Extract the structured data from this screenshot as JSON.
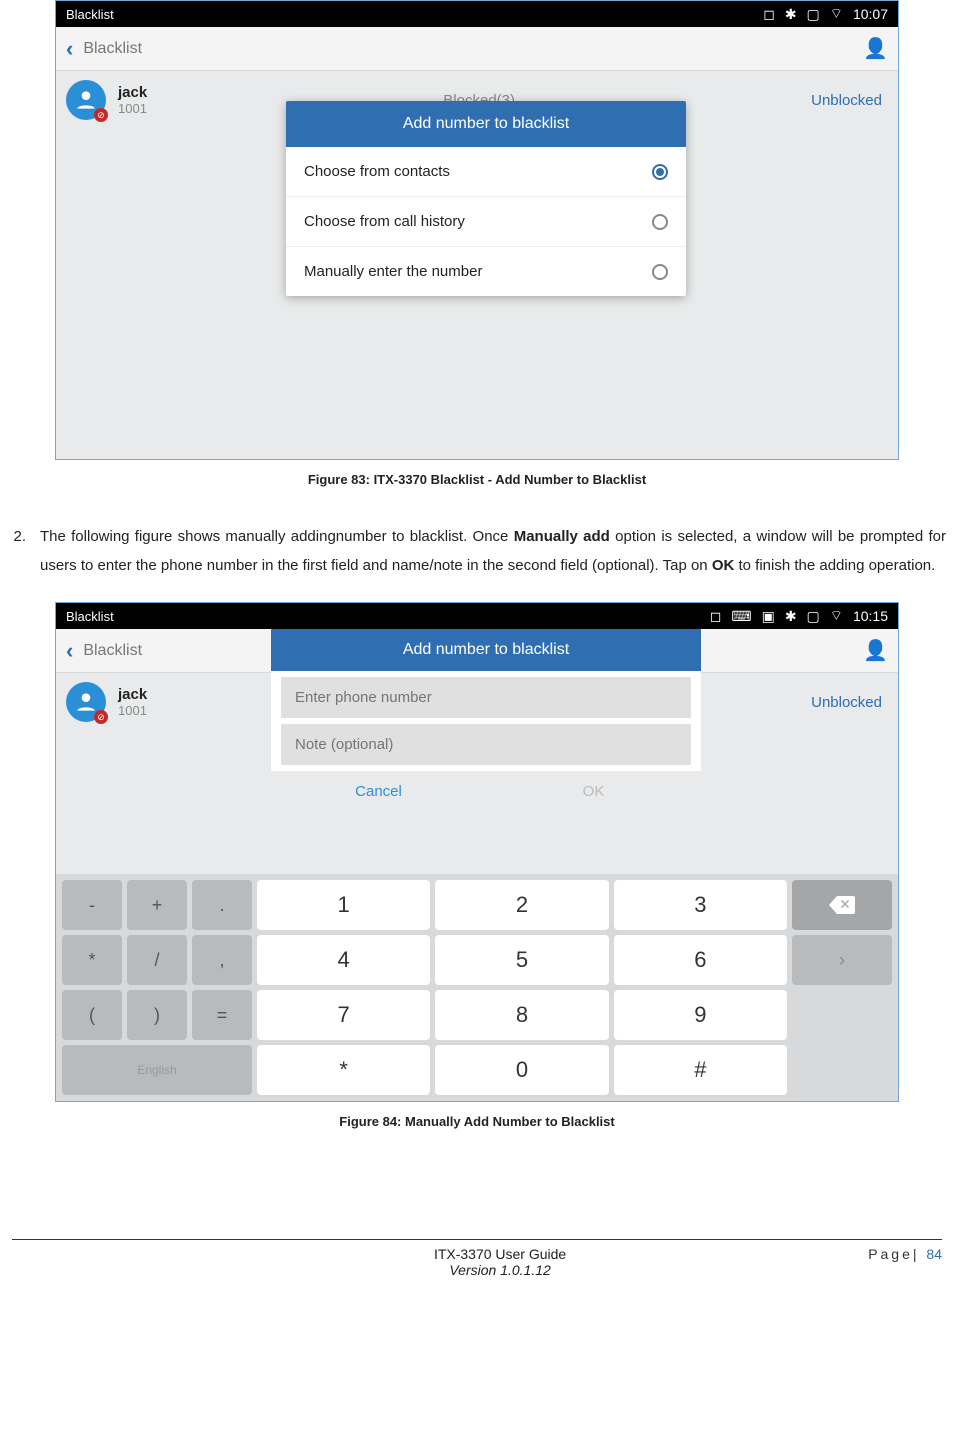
{
  "fig83": {
    "statusbar": {
      "title": "Blacklist",
      "time": "10:07"
    },
    "appbar": {
      "title": "Blacklist"
    },
    "contact": {
      "name": "jack",
      "number": "1001",
      "blocked": "Blocked(3)",
      "unblocked": "Unblocked"
    },
    "dialog": {
      "title": "Add number to blacklist",
      "opt1": "Choose from contacts",
      "opt2": "Choose from call history",
      "opt3": "Manually enter the number"
    },
    "caption": "Figure 83: ITX-3370 Blacklist - Add Number to Blacklist"
  },
  "para": {
    "num": "2.",
    "t1": "The following figure shows manually addingnumber to blacklist. Once ",
    "b1": "Manually add",
    "t2": " option is selected, a window will be prompted for users to enter the phone number in the first field and name/note in the second field (optional). Tap on ",
    "b2": "OK",
    "t3": " to finish the adding operation."
  },
  "fig84": {
    "statusbar": {
      "title": "Blacklist",
      "time": "10:15"
    },
    "appbar": {
      "title": "Blacklist"
    },
    "contact": {
      "name": "jack",
      "number": "1001",
      "unblocked": "Unblocked"
    },
    "dialog": {
      "title": "Add number to blacklist",
      "ph_phone": "Enter phone number",
      "ph_note": "Note (optional)",
      "cancel": "Cancel",
      "ok": "OK"
    },
    "kbd": {
      "r1c1": "-",
      "r1c2": "+",
      "r1c3": ".",
      "r1c4": "1",
      "r1c5": "2",
      "r1c6": "3",
      "r2c1": "*",
      "r2c2": "/",
      "r2c3": ",",
      "r2c4": "4",
      "r2c5": "5",
      "r2c6": "6",
      "r3c1": "(",
      "r3c2": ")",
      "r3c3": "=",
      "r3c4": "7",
      "r3c5": "8",
      "r3c6": "9",
      "lang": "English",
      "r4c4": "*",
      "r4c5": "0",
      "r4c6": "#"
    },
    "caption": "Figure 84: Manually Add Number to Blacklist"
  },
  "footer": {
    "guide": "ITX-3370 User Guide",
    "version": "Version 1.0.1.12",
    "page_label": "Page|",
    "page_num": "84"
  }
}
